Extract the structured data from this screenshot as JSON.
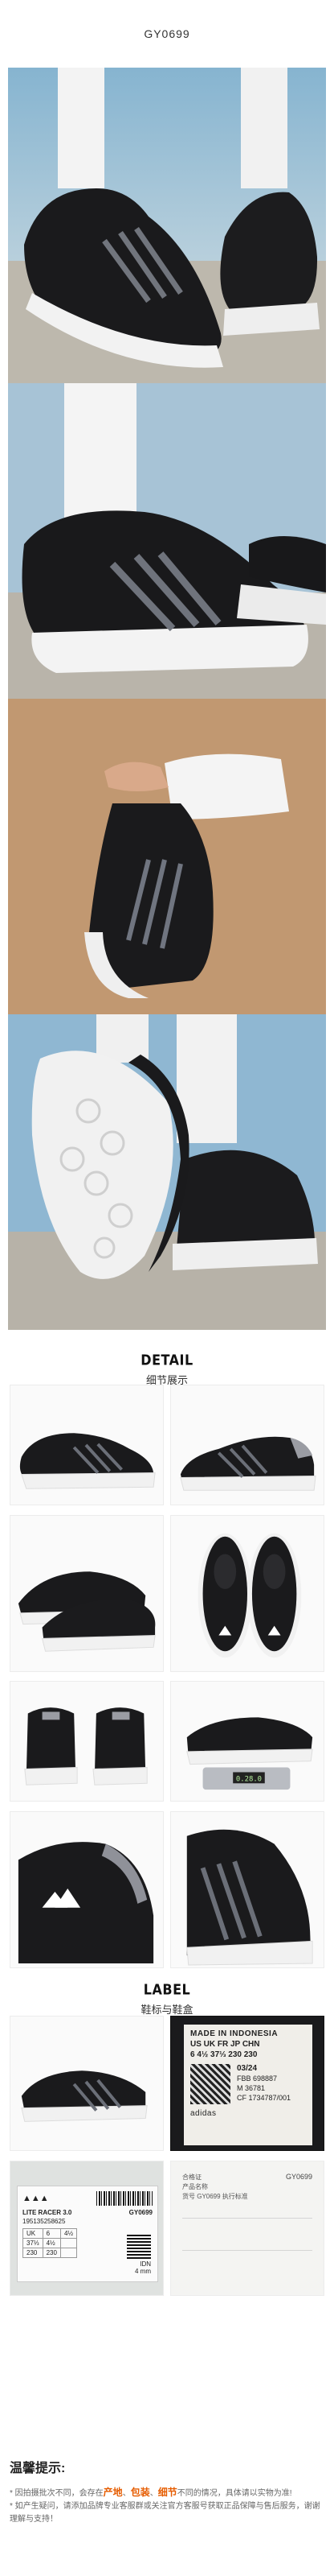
{
  "product": {
    "code": "GY0699"
  },
  "detail_section": {
    "title_en": "DETAIL",
    "title_cn": "细节展示"
  },
  "label_section": {
    "title_en": "LABEL",
    "title_cn": "鞋标与鞋盒"
  },
  "inner_label": {
    "line1": "MADE IN INDONESIA",
    "line2": "US UK FR JP CHN",
    "line3": "6  4½  37⅓  230  230",
    "date": "03/24",
    "codes": [
      "FBB 698887",
      "M 36781",
      "CF 1734787/001"
    ],
    "brand": "adidas"
  },
  "box_label": {
    "name": "LITE RACER 3.0",
    "barcode_number": "195135258625",
    "sizes_row1": [
      "UK",
      "6",
      "4½"
    ],
    "sizes_row2": [
      "37⅓",
      "4½",
      ""
    ],
    "sizes_row3": [
      "230",
      "230",
      ""
    ],
    "article": "GY0699",
    "made_in": "IDN",
    "qr_text": "4 mm"
  },
  "box_info": {
    "left_text": [
      "合格证",
      "产品名称",
      "货号 GY0699 执行标准"
    ],
    "right_code": "GY0699"
  },
  "scale_display": "0.28.0",
  "tips": {
    "title": "温馨提示:",
    "line1_prefix": "* 因拍摄批次不同，会存在",
    "k1": "产地",
    "sep1": "、",
    "k2": "包装",
    "sep2": "、",
    "k3": "细节",
    "line1_suffix": "不同的情况，具体请以实物为准!",
    "line2": "* 如产生疑问，请添加品牌专业客服群或关注官方客服号获取正品保障与售后服务，谢谢理解与支持！"
  },
  "colors": {
    "shoe_black": "#1a1a1c",
    "sole_white": "#f4f4f4",
    "sky_blue": "#9bbfd6",
    "tips_accent": "#e65c00"
  }
}
